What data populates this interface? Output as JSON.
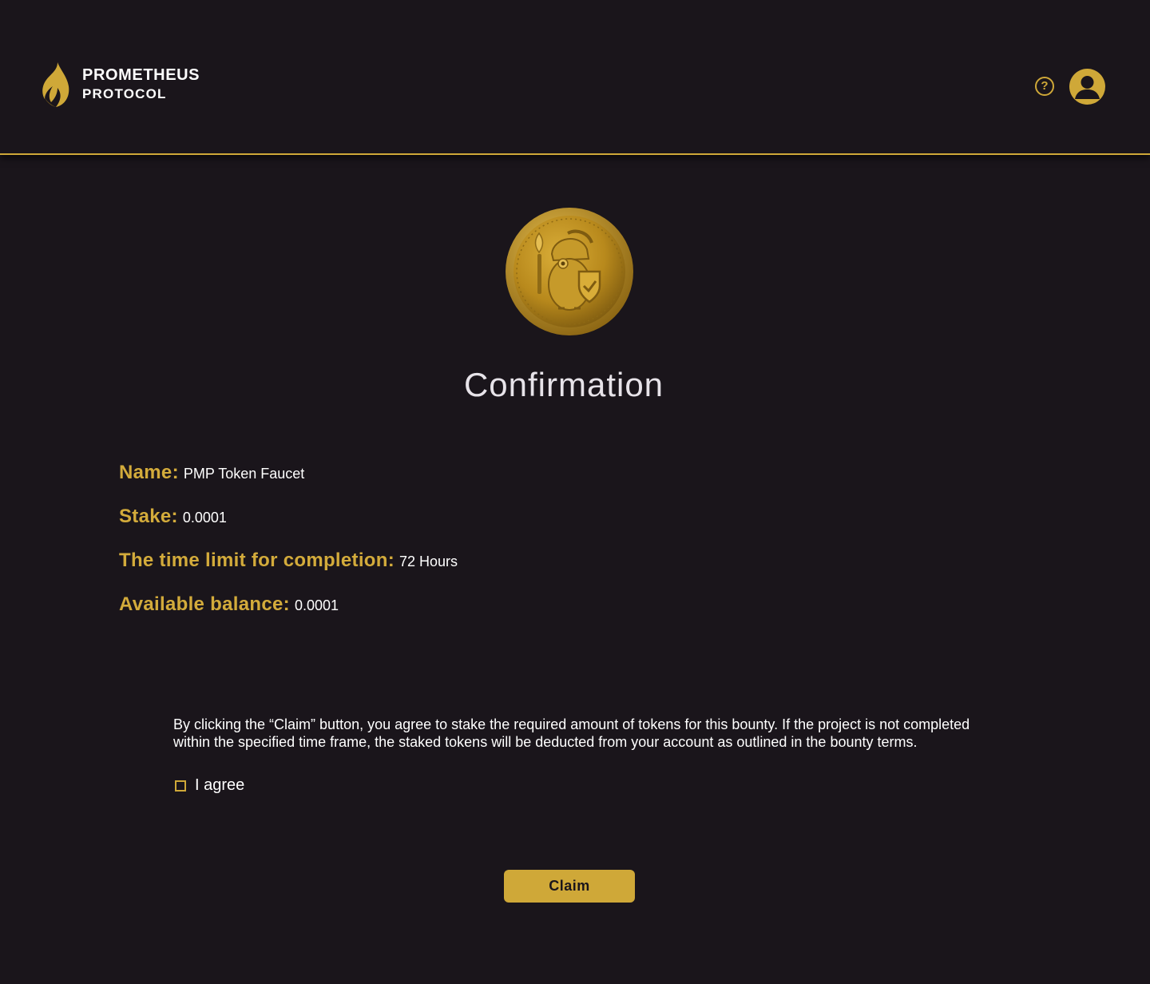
{
  "header": {
    "brand_line1": "PROMETHEUS",
    "brand_line2": "PROTOCOL",
    "help_icon": "question-circle-icon",
    "help_glyph": "?",
    "avatar_icon": "user-avatar-icon"
  },
  "coin_icon": "gold-coin-owl-icon",
  "title": "Confirmation",
  "details": {
    "name_label": "Name:",
    "name_value": "PMP Token Faucet",
    "stake_label": "Stake:",
    "stake_value": "0.0001",
    "time_label": "The time limit for completion:",
    "time_value": "72 Hours",
    "balance_label": "Available balance:",
    "balance_value": "0.0001"
  },
  "terms": {
    "text": "By clicking the “Claim” button, you agree to stake the required amount of tokens for this bounty. If the project is not completed within the specified time frame, the staked tokens will be deducted from your account as outlined in the bounty terms.",
    "agree_label": "I agree",
    "agree_checked": false
  },
  "claim_label": "Claim",
  "colors": {
    "background": "#1a151b",
    "accent": "#cfa838",
    "text": "#ffffff",
    "title": "#e7e3e9"
  }
}
